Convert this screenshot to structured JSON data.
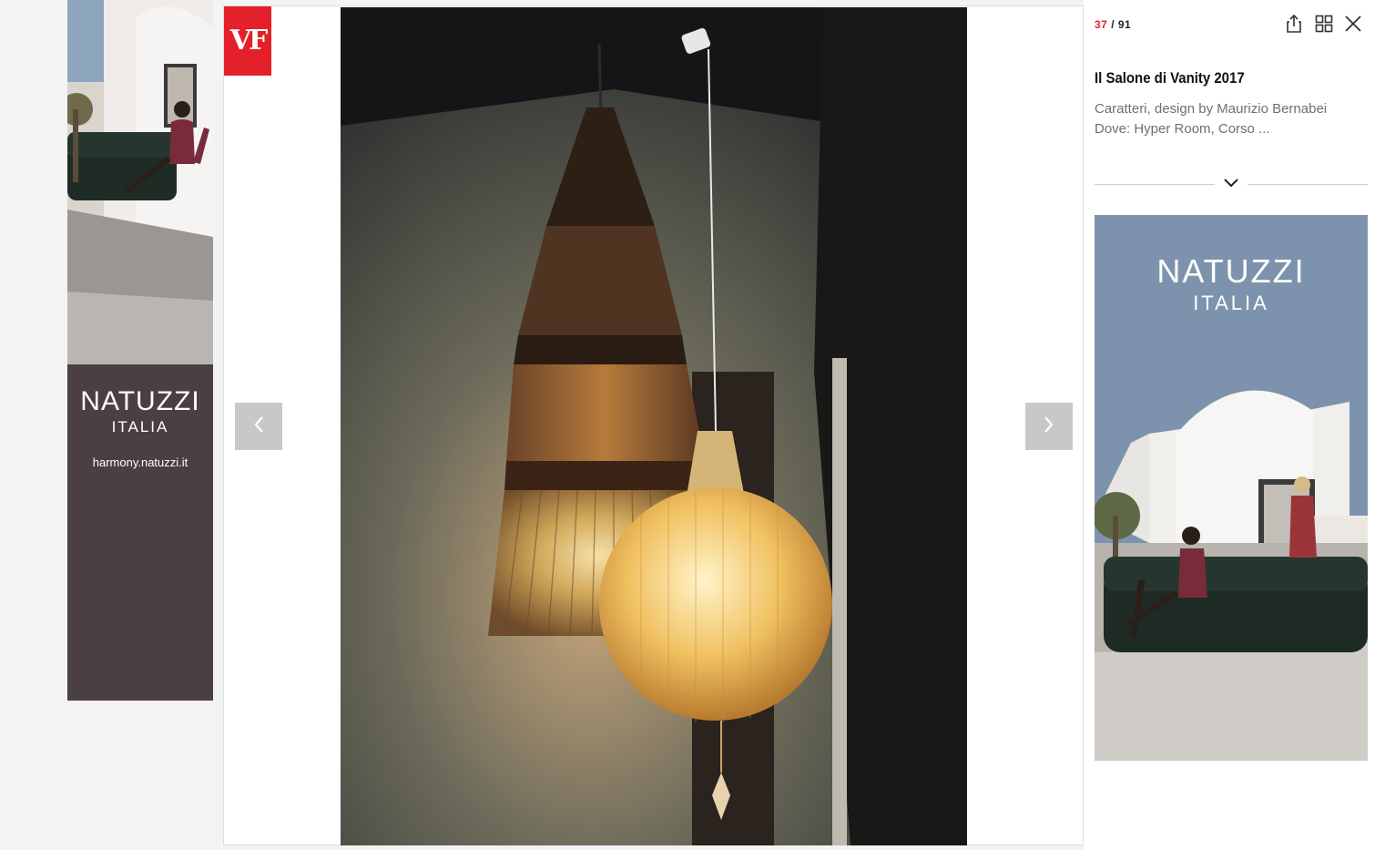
{
  "ad_left": {
    "brand": "NATUZZI",
    "sub": "ITALIA",
    "url": "harmony.natuzzi.it"
  },
  "logo": {
    "text": "VF"
  },
  "gallery": {
    "current": "37",
    "sep": " / ",
    "total": "91",
    "title": "Il Salone di Vanity 2017",
    "desc_line1": "Caratteri, design by Maurizio Bernabei",
    "desc_line2": "Dove: Hyper Room, Corso ...",
    "icons": {
      "share": "share-icon",
      "grid": "grid-icon",
      "close": "close-icon",
      "prev": "chevron-left-icon",
      "next": "chevron-right-icon",
      "expand": "chevron-down-icon"
    }
  },
  "ad_right": {
    "brand": "NATUZZI",
    "sub": "ITALIA"
  },
  "colors": {
    "accent": "#e4202a",
    "ad_left_bg": "#4b3f46",
    "ad_right_bg": "#7d93ad"
  }
}
